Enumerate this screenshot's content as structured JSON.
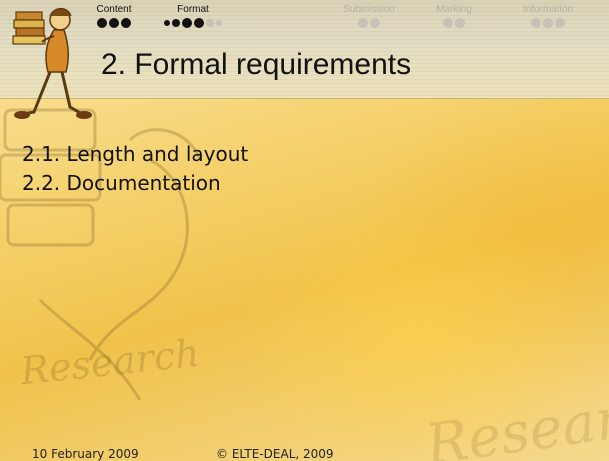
{
  "nav": {
    "items": [
      {
        "label": "Content",
        "state": "visited"
      },
      {
        "label": "Format",
        "state": "current"
      },
      {
        "label": "Submission",
        "state": "upcoming"
      },
      {
        "label": "Marking",
        "state": "upcoming"
      },
      {
        "label": "Information",
        "state": "upcoming"
      }
    ]
  },
  "slide": {
    "title": "2. Formal requirements",
    "items": [
      "2.1. Length and layout",
      "2.2. Documentation"
    ]
  },
  "watermark": {
    "text_left": "Research",
    "text_right": "Research"
  },
  "footer": {
    "date": "10 February 2009",
    "copyright": "© ELTE-DEAL, 2009"
  },
  "colors": {
    "accent_dark": "#111111",
    "inactive_grey": "#b5b2a6",
    "background_gold": "#f0c24b"
  }
}
